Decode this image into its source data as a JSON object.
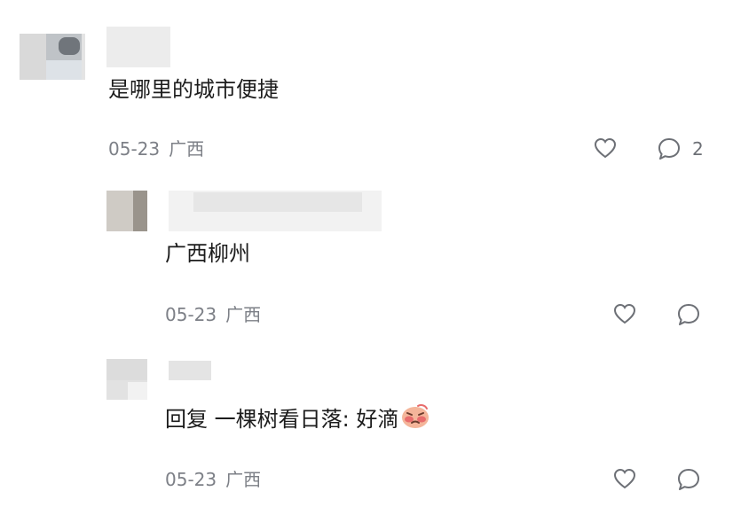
{
  "comments": [
    {
      "text": "是哪里的城市便捷",
      "date": "05-23",
      "location": "广西",
      "reply_count": "2"
    },
    {
      "text": "广西柳州",
      "date": "05-23",
      "location": "广西"
    },
    {
      "text": "回复 一棵树看日落: 好滴",
      "date": "05-23",
      "location": "广西"
    }
  ],
  "colors": {
    "meta": "#7d8087",
    "icon": "#6d7076",
    "text": "#1c1c1c"
  },
  "icons": {
    "like": "heart-outline-icon",
    "reply": "speech-bubble-icon",
    "emoji": "embarrassed-face-emoji"
  }
}
